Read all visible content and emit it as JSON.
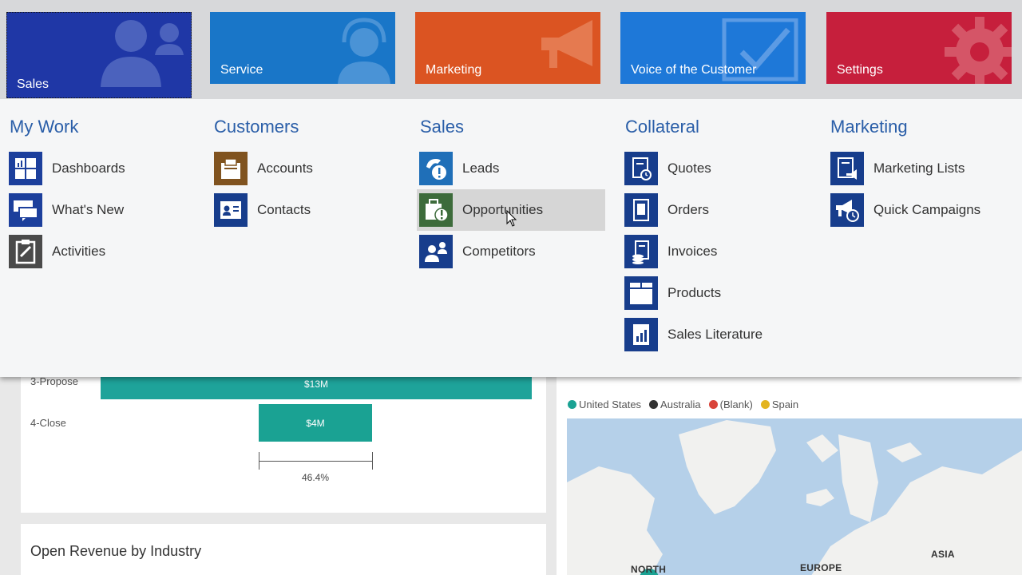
{
  "tiles": [
    {
      "id": "sales",
      "label": "Sales",
      "color": "#1f37a6",
      "icon": "people-icon"
    },
    {
      "id": "service",
      "label": "Service",
      "color": "#1976c8",
      "icon": "headset-icon"
    },
    {
      "id": "marketing",
      "label": "Marketing",
      "color": "#db5422",
      "icon": "megaphone-icon"
    },
    {
      "id": "voc",
      "label": "Voice of the Customer",
      "color": "#1e78d8",
      "icon": "checkbox-icon"
    },
    {
      "id": "settings",
      "label": "Settings",
      "color": "#c61f3c",
      "icon": "gear-icon"
    }
  ],
  "groups": {
    "my_work": {
      "title": "My Work",
      "items": [
        {
          "label": "Dashboards",
          "icon": "dashboard-icon"
        },
        {
          "label": "What's New",
          "icon": "chat-icon"
        },
        {
          "label": "Activities",
          "icon": "clipboard-icon"
        }
      ]
    },
    "customers": {
      "title": "Customers",
      "items": [
        {
          "label": "Accounts",
          "icon": "building-icon"
        },
        {
          "label": "Contacts",
          "icon": "contact-card-icon"
        }
      ]
    },
    "sales": {
      "title": "Sales",
      "items": [
        {
          "label": "Leads",
          "icon": "phone-alert-icon"
        },
        {
          "label": "Opportunities",
          "icon": "opportunity-icon",
          "hovered": true
        },
        {
          "label": "Competitors",
          "icon": "competitors-icon"
        }
      ]
    },
    "collateral": {
      "title": "Collateral",
      "items": [
        {
          "label": "Quotes",
          "icon": "quote-doc-icon"
        },
        {
          "label": "Orders",
          "icon": "order-doc-icon"
        },
        {
          "label": "Invoices",
          "icon": "invoice-icon"
        },
        {
          "label": "Products",
          "icon": "product-box-icon"
        },
        {
          "label": "Sales Literature",
          "icon": "literature-icon"
        }
      ]
    },
    "marketing": {
      "title": "Marketing",
      "items": [
        {
          "label": "Marketing Lists",
          "icon": "marketing-list-icon"
        },
        {
          "label": "Quick Campaigns",
          "icon": "campaign-icon"
        }
      ]
    }
  },
  "dashboard": {
    "funnel": {
      "stages": [
        {
          "label": "3-Propose",
          "value": "$13M"
        },
        {
          "label": "4-Close",
          "value": "$4M"
        }
      ],
      "conversion": "46.4%"
    },
    "revenue_title": "Open Revenue by Industry",
    "map": {
      "legend": [
        {
          "label": "United States",
          "color": "#1aa293"
        },
        {
          "label": "Australia",
          "color": "#333333"
        },
        {
          "label": "(Blank)",
          "color": "#d9443a"
        },
        {
          "label": "Spain",
          "color": "#e3b420"
        }
      ],
      "labels": [
        "NORTH",
        "EUROPE",
        "ASIA"
      ]
    }
  }
}
